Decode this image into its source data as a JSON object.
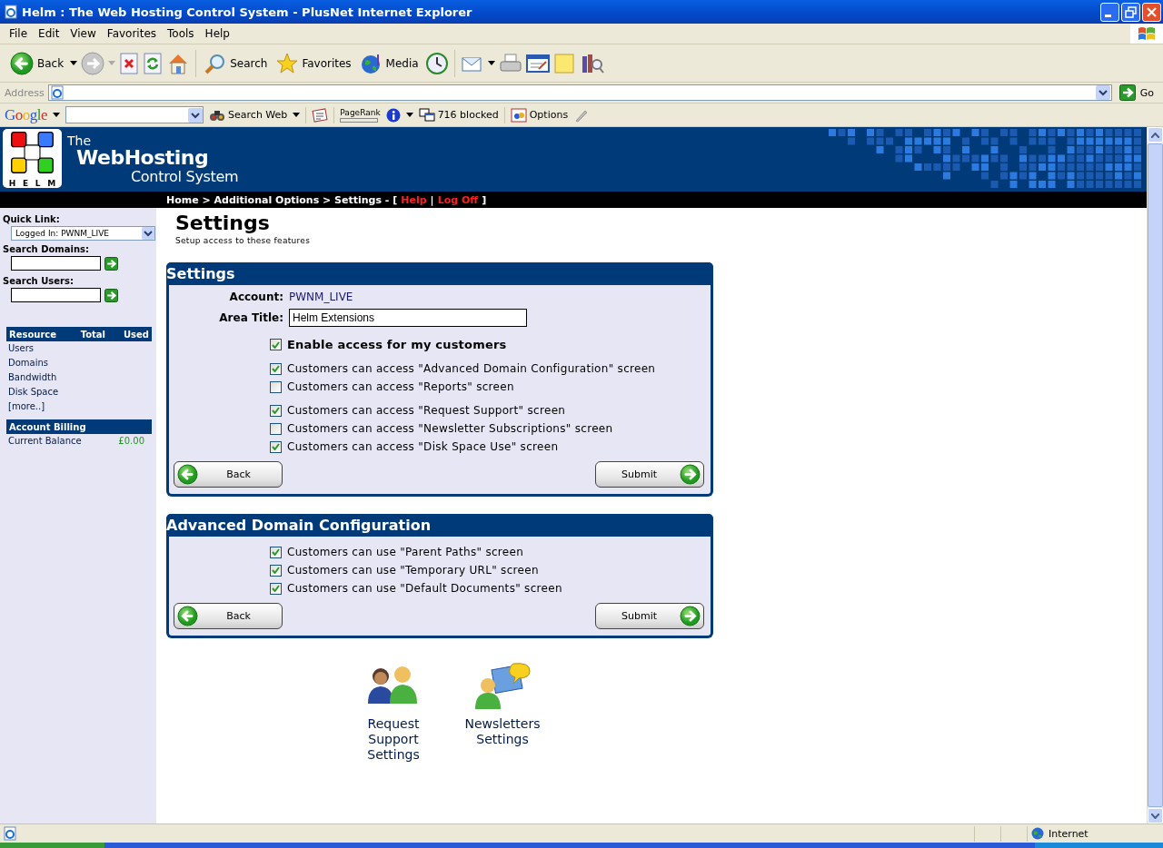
{
  "window": {
    "title": "Helm : The Web Hosting Control System - PlusNet Internet Explorer"
  },
  "menu": [
    "File",
    "Edit",
    "View",
    "Favorites",
    "Tools",
    "Help"
  ],
  "toolbar": {
    "back": "Back",
    "search": "Search",
    "favorites": "Favorites",
    "media": "Media"
  },
  "address": {
    "label": "Address",
    "go": "Go"
  },
  "google_bar": {
    "logo": "Google",
    "search_web": "Search Web",
    "pagerank": "PageRank",
    "blocked": "716 blocked",
    "options": "Options"
  },
  "header": {
    "the": "The",
    "title": "WebHosting",
    "subtitle": "Control System",
    "logo_letters": [
      "H",
      "E",
      "L",
      "M"
    ]
  },
  "breadcrumb": {
    "trail": "Home > Additional Options > Settings - [",
    "help": "Help",
    "separator": "|",
    "logoff": "Log Off",
    "end": "]"
  },
  "sidebar": {
    "quick_link": {
      "label": "Quick Link:",
      "value": "Logged In: PWNM_LIVE"
    },
    "search_domains": {
      "label": "Search Domains:"
    },
    "search_users": {
      "label": "Search Users:"
    },
    "resources": {
      "columns": [
        "Resource",
        "Total",
        "Used"
      ],
      "rows": [
        "Users",
        "Domains",
        "Bandwidth",
        "Disk Space"
      ],
      "more": "[more..]"
    },
    "billing": {
      "title": "Account Billing",
      "rows": [
        {
          "label": "Current Balance",
          "value": "£0.00"
        }
      ]
    }
  },
  "page": {
    "title": "Settings",
    "subtitle": "Setup access to these features"
  },
  "panels": [
    {
      "title": "Settings",
      "fields": [
        {
          "label": "Account:",
          "kind": "text",
          "value": "PWNM_LIVE"
        },
        {
          "label": "Area Title:",
          "kind": "input",
          "value": "Helm Extensions"
        }
      ],
      "groups": [
        [
          {
            "label": "Enable access for my customers",
            "kind": "master",
            "checked": true
          }
        ],
        [
          {
            "label": "Customers can access \"Advanced Domain Configuration\" screen",
            "kind": "option",
            "checked": true
          },
          {
            "label": "Customers can access \"Reports\" screen",
            "kind": "option",
            "checked": false
          }
        ],
        [
          {
            "label": "Customers can access \"Request Support\" screen",
            "kind": "option",
            "checked": true
          },
          {
            "label": "Customers can access \"Newsletter Subscriptions\" screen",
            "kind": "option",
            "checked": false
          },
          {
            "label": "Customers can access \"Disk Space Use\" screen",
            "kind": "option",
            "checked": true
          }
        ]
      ],
      "back": "Back",
      "submit": "Submit"
    },
    {
      "title": "Advanced Domain Configuration",
      "groups": [
        [
          {
            "label": "Customers can use \"Parent Paths\" screen",
            "kind": "option",
            "checked": true
          },
          {
            "label": "Customers can use \"Temporary URL\" screen",
            "kind": "option",
            "checked": true
          },
          {
            "label": "Customers can use \"Default Documents\" screen",
            "kind": "option",
            "checked": true
          }
        ]
      ],
      "back": "Back",
      "submit": "Submit"
    }
  ],
  "shortcuts": [
    {
      "label": "Request Support Settings",
      "kind": "support"
    },
    {
      "label": "Newsletters Settings",
      "kind": "newsletter"
    }
  ],
  "status": {
    "zone": "Internet"
  }
}
